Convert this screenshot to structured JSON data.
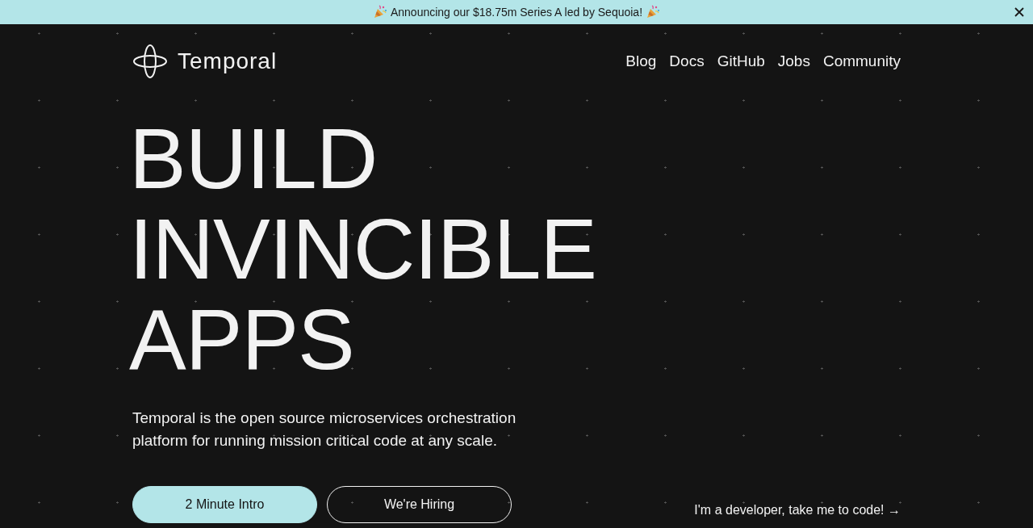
{
  "announcement": {
    "text": "Announcing our $18.75m Series A led by Sequoia!"
  },
  "brand": {
    "name": "Temporal"
  },
  "nav": [
    "Blog",
    "Docs",
    "GitHub",
    "Jobs",
    "Community"
  ],
  "headline": "BUILD INVINCIBLE APPS",
  "description": "Temporal is the open source microservices orchestration platform for running mission critical code at any scale.",
  "buttons": [
    {
      "label": "2 Minute Intro",
      "kind": "primary"
    },
    {
      "label": "We're Hiring",
      "kind": "outline"
    }
  ],
  "developer_link": "I'm a developer, take me to code! →"
}
